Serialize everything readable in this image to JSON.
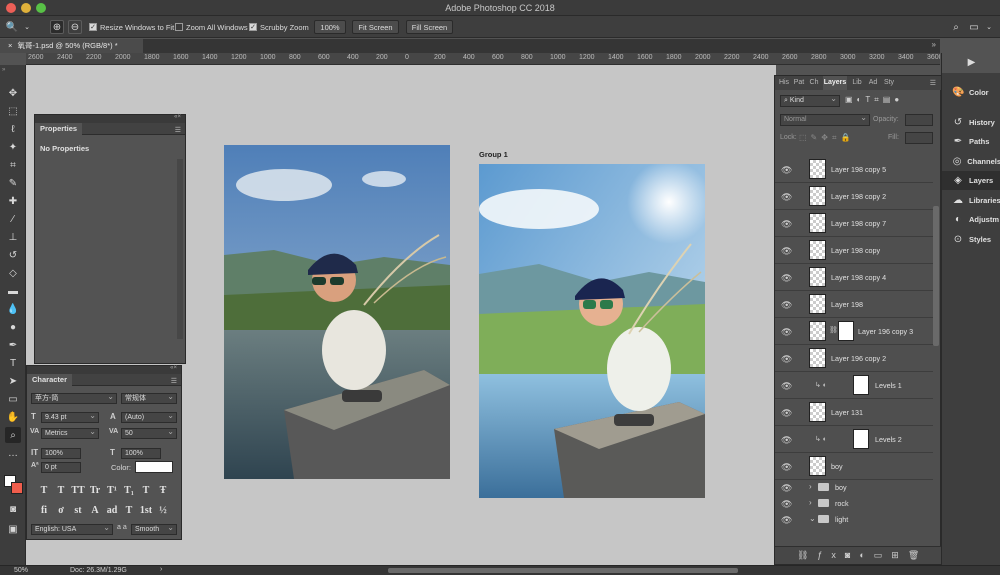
{
  "app": {
    "title": "Adobe Photoshop CC 2018"
  },
  "options_bar": {
    "resize_windows": "Resize Windows to Fit",
    "zoom_all": "Zoom All Windows",
    "scrubby_zoom": "Scrubby Zoom",
    "zoom_value": "100%",
    "fit_screen": "Fit Screen",
    "fill_screen": "Fill Screen"
  },
  "document_tab": {
    "label": "氧哥-1.psd @ 50% (RGB/8*) *"
  },
  "ruler_labels": [
    "2600",
    "2400",
    "2200",
    "2000",
    "1800",
    "1600",
    "1400",
    "1200",
    "1000",
    "800",
    "600",
    "400",
    "200",
    "0",
    "200",
    "400",
    "600",
    "800",
    "1000",
    "1200",
    "1400",
    "1600",
    "1800",
    "2000",
    "2200",
    "2400",
    "2600",
    "2800",
    "3000",
    "3200",
    "3400",
    "3600",
    "3800",
    "4000",
    "4200",
    "4400"
  ],
  "canvas": {
    "group_label": "Group 1"
  },
  "properties_panel": {
    "tab": "Properties",
    "body": "No Properties"
  },
  "character_panel": {
    "tab": "Character",
    "font_family": "苹方-简",
    "font_style": "常规体",
    "size": "9.43 pt",
    "leading": "(Auto)",
    "kerning": "Metrics",
    "tracking": "50",
    "vertical_scale": "100%",
    "horizontal_scale": "100%",
    "baseline_shift": "0 pt",
    "color_label": "Color:",
    "language": "English: USA",
    "aa_label": "a a",
    "anti_alias": "Smooth",
    "type_buttons": [
      "T",
      "T",
      "TT",
      "Tr",
      "T¹",
      "T₁",
      "T",
      "Ŧ"
    ],
    "opentype_buttons": [
      "fi",
      "ơ",
      "st",
      "A",
      "ad",
      "T",
      "1st",
      "½"
    ]
  },
  "layers_panel": {
    "tabs": [
      "His",
      "Pat",
      "Ch",
      "Layers",
      "Lib",
      "Ad",
      "Sty"
    ],
    "filter_kind": "Kind",
    "blend_mode": "Normal",
    "opacity_label": "Opacity:",
    "lock_label": "Lock:",
    "fill_label": "Fill:",
    "layers": [
      {
        "name": "Layer 198 copy 5",
        "type": "pixel"
      },
      {
        "name": "Layer 198 copy 2",
        "type": "pixel"
      },
      {
        "name": "Layer 198 copy 7",
        "type": "pixel"
      },
      {
        "name": "Layer 198 copy",
        "type": "pixel"
      },
      {
        "name": "Layer 198 copy 4",
        "type": "pixel"
      },
      {
        "name": "Layer 198",
        "type": "pixel"
      },
      {
        "name": "Layer 196 copy 3",
        "type": "masked"
      },
      {
        "name": "Layer 196 copy 2",
        "type": "pixel"
      },
      {
        "name": "Levels 1",
        "type": "adjust"
      },
      {
        "name": "Layer 131",
        "type": "pixel"
      },
      {
        "name": "Levels 2",
        "type": "adjust"
      },
      {
        "name": "boy",
        "type": "pixel"
      }
    ],
    "groups": [
      "boy",
      "rock",
      "light"
    ]
  },
  "right_dock": [
    "Color",
    "History",
    "Paths",
    "Channels",
    "Layers",
    "Libraries",
    "Adjustm",
    "Styles"
  ],
  "status_bar": {
    "zoom": "50%",
    "doc": "Doc: 26.3M/1.29G"
  }
}
